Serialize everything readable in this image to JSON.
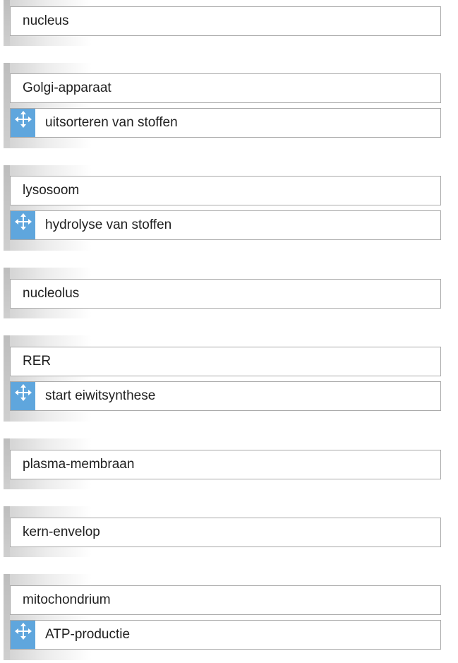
{
  "icons": {
    "drag_handle": "move-arrows-icon"
  },
  "colors": {
    "handle": "#5fa6dd",
    "box_border": "#a9a9a9"
  },
  "groups": [
    {
      "label": "nucleus",
      "answer": null
    },
    {
      "label": "Golgi-apparaat",
      "answer": "uitsorteren van stoffen"
    },
    {
      "label": "lysosoom",
      "answer": "hydrolyse van stoffen"
    },
    {
      "label": "nucleolus",
      "answer": null
    },
    {
      "label": "RER",
      "answer": "start eiwitsynthese"
    },
    {
      "label": "plasma-membraan",
      "answer": null
    },
    {
      "label": "kern-envelop",
      "answer": null
    },
    {
      "label": "mitochondrium",
      "answer": "ATP-productie"
    }
  ]
}
